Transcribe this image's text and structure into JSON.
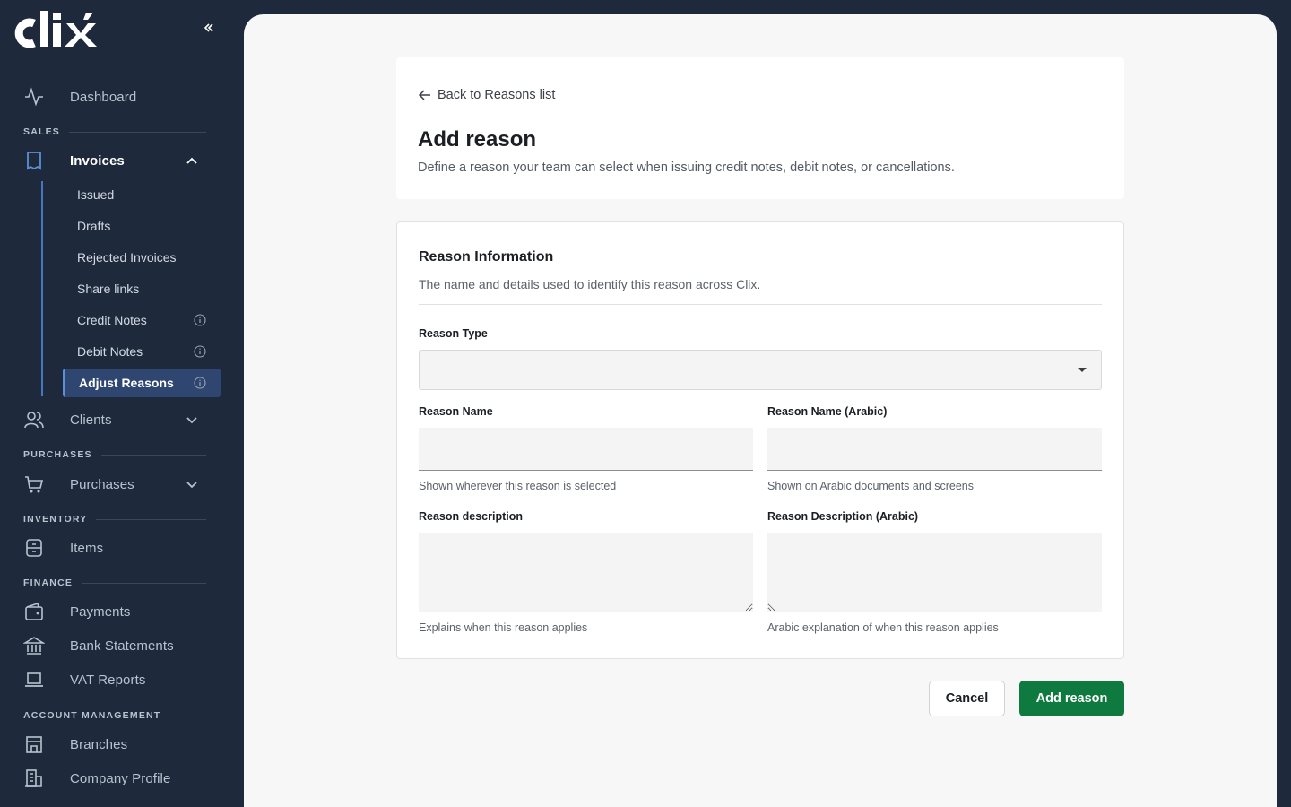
{
  "brand": {
    "logo_text": "clix",
    "accent": "#4677c0",
    "primary_button": "#0f7a3f"
  },
  "sidebar": {
    "collapse_icon": "double-chevron-left-icon",
    "dashboard": {
      "label": "Dashboard",
      "icon": "activity-icon"
    },
    "sections": {
      "sales": "SALES",
      "purchases": "PURCHASES",
      "inventory": "INVENTORY",
      "finance": "FINANCE",
      "account": "ACCOUNT MANAGEMENT"
    },
    "invoices": {
      "label": "Invoices",
      "icon": "receipt-icon",
      "expanded": true,
      "items": [
        {
          "label": "Issued",
          "info": false
        },
        {
          "label": "Drafts",
          "info": false
        },
        {
          "label": "Rejected Invoices",
          "info": false
        },
        {
          "label": "Share links",
          "info": false
        },
        {
          "label": "Credit Notes",
          "info": true
        },
        {
          "label": "Debit Notes",
          "info": true
        },
        {
          "label": "Adjust Reasons",
          "info": true,
          "active": true
        }
      ]
    },
    "clients": {
      "label": "Clients",
      "icon": "users-icon"
    },
    "purchases": {
      "label": "Purchases",
      "icon": "cart-icon"
    },
    "items": {
      "label": "Items",
      "icon": "box-icon"
    },
    "payments": {
      "label": "Payments",
      "icon": "wallet-icon"
    },
    "bank_statements": {
      "label": "Bank Statements",
      "icon": "bank-icon"
    },
    "vat_reports": {
      "label": "VAT Reports",
      "icon": "laptop-icon"
    },
    "branches": {
      "label": "Branches",
      "icon": "store-icon"
    },
    "company_profile": {
      "label": "Company Profile",
      "icon": "building-icon"
    }
  },
  "header": {
    "back_label": "Back to Reasons list",
    "title": "Add reason",
    "subtitle": "Define a reason your team can select when issuing credit notes, debit notes, or cancellations."
  },
  "form": {
    "section_title": "Reason Information",
    "section_subtitle": "The name and details used to identify this reason across Clix.",
    "reason_type": {
      "label": "Reason Type",
      "value": ""
    },
    "reason_name": {
      "label": "Reason Name",
      "value": "",
      "helper": "Shown wherever this reason is selected"
    },
    "reason_name_ar": {
      "label": "Reason Name (Arabic)",
      "value": "",
      "helper": "Shown on Arabic documents and screens"
    },
    "reason_desc": {
      "label": "Reason description",
      "value": "",
      "helper": "Explains when this reason applies"
    },
    "reason_desc_ar": {
      "label": "Reason Description (Arabic)",
      "value": "",
      "helper": "Arabic explanation of when this reason applies"
    }
  },
  "actions": {
    "cancel": "Cancel",
    "submit": "Add reason"
  }
}
